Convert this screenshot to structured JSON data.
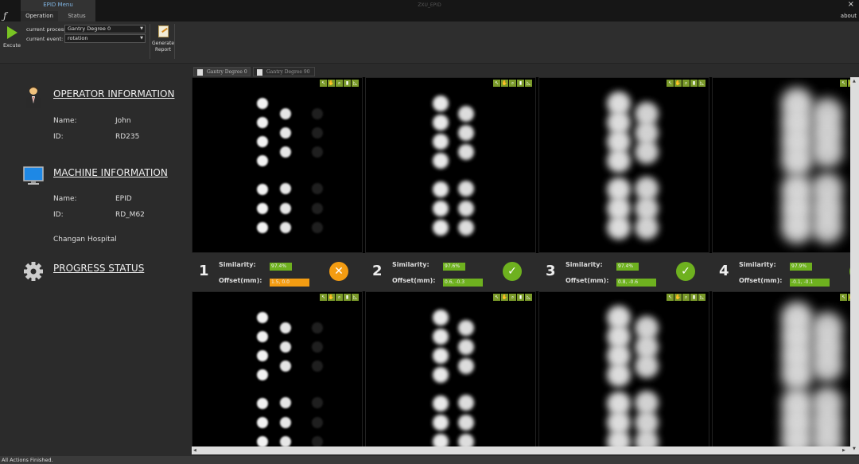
{
  "window": {
    "title": "ZXU_EPID",
    "close": "×",
    "about": "about"
  },
  "ribbon": {
    "group_title": "EPID Menu",
    "tabs": [
      "Operation",
      "Status"
    ]
  },
  "toolbar": {
    "execute_label": "Excute",
    "process_label": "current process:",
    "process_value": "Gantry Degree 0",
    "event_label": "current event:",
    "event_value": "rotation",
    "report_label_1": "Generate",
    "report_label_2": "Report"
  },
  "operator": {
    "heading": "OPERATOR INFORMATION",
    "name_label": "Name:",
    "name": "John",
    "id_label": "ID:",
    "id": "RD235"
  },
  "machine": {
    "heading": "MACHINE INFORMATION",
    "name_label": "Name:",
    "name": "EPID",
    "id_label": "ID:",
    "id": "RD_M62",
    "location": "Changan Hospital"
  },
  "progress": {
    "heading": "PROGRESS STATUS"
  },
  "doc_tabs": [
    "Gantry Degree 0",
    "Gantry Degree 90"
  ],
  "results": [
    {
      "num": "1",
      "similarity_label": "Similarity:",
      "similarity": "97.4%",
      "offset_label": "Offset(mm):",
      "offset": "1.5, 0.0",
      "status": "fail"
    },
    {
      "num": "2",
      "similarity_label": "Similarity:",
      "similarity": "97.6%",
      "offset_label": "Offset(mm):",
      "offset": "0.6, -0.3",
      "status": "ok"
    },
    {
      "num": "3",
      "similarity_label": "Similarity:",
      "similarity": "97.4%",
      "offset_label": "Offset(mm):",
      "offset": "0.8, -0.6",
      "status": "ok"
    },
    {
      "num": "4",
      "similarity_label": "Similarity:",
      "similarity": "97.9%",
      "offset_label": "Offset(mm):",
      "offset": "-0.1, -0.1",
      "status": "ok"
    }
  ],
  "status_bar": "All Actions Finished.",
  "colors": {
    "ok": "#6eb11f",
    "warn": "#f39c12",
    "tool": "#7a9a2a"
  }
}
